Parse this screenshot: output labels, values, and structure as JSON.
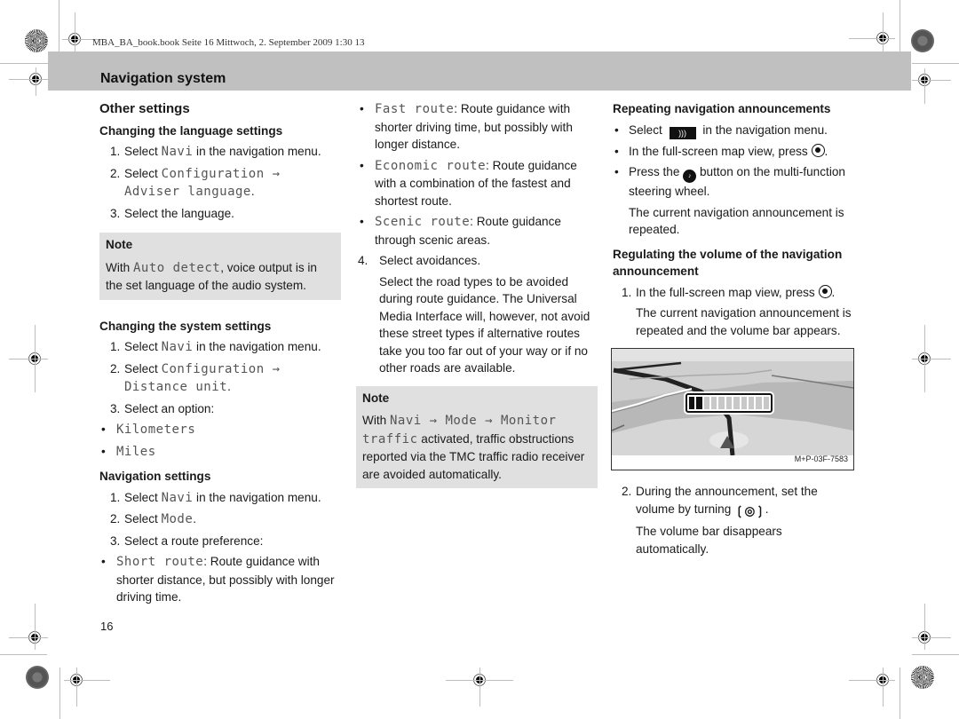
{
  "slug": "MBA_BA_book.book  Seite 16  Mittwoch, 2. September 2009  1:30 13",
  "section_title": "Navigation system",
  "page_number": "16",
  "col1": {
    "heading": "Other settings",
    "language": {
      "title": "Changing the language settings",
      "steps": [
        {
          "num": "1.",
          "pre": "Select ",
          "code": "Navi",
          "post": " in the navigation menu."
        },
        {
          "num": "2.",
          "pre": "Select ",
          "code": "Configuration → Adviser language",
          "post": "."
        },
        {
          "num": "3.",
          "pre": "Select the language.",
          "code": "",
          "post": ""
        }
      ]
    },
    "note": {
      "title": "Note",
      "pre": "With ",
      "code": "Auto detect",
      "post": ", voice output is in the set language of the audio system."
    },
    "system": {
      "title": "Changing the system settings",
      "steps": [
        {
          "num": "1.",
          "pre": "Select ",
          "code": "Navi",
          "post": " in the navigation menu."
        },
        {
          "num": "2.",
          "pre": "Select ",
          "code": "Configuration → Distance unit",
          "post": "."
        },
        {
          "num": "3.",
          "pre": "Select an option:",
          "code": "",
          "post": ""
        }
      ],
      "options": [
        "Kilometers",
        "Miles"
      ]
    },
    "navigation": {
      "title": "Navigation settings",
      "steps": [
        {
          "num": "1.",
          "pre": "Select ",
          "code": "Navi",
          "post": " in the navigation menu."
        },
        {
          "num": "2.",
          "pre": "Select ",
          "code": "Mode",
          "post": "."
        },
        {
          "num": "3.",
          "pre": "Select a route preference:",
          "code": "",
          "post": ""
        }
      ],
      "routes": [
        {
          "code": "Short route",
          "text": ": Route guidance with shorter distance, but possibly with longer driving time."
        }
      ]
    }
  },
  "col2": {
    "routes": [
      {
        "code": "Fast route",
        "text": ": Route guidance with shorter driving time, but possibly with longer distance."
      },
      {
        "code": "Economic route",
        "text": ": Route guidance with a combination of the fastest and shortest route."
      },
      {
        "code": "Scenic route",
        "text": ": Route guidance through scenic areas."
      }
    ],
    "step4": {
      "num": "4.",
      "text": "Select avoidances."
    },
    "step4_detail": "Select the road types to be avoided during route guidance. The Universal Media Interface will, however, not avoid these street types if alternative routes take you too far out of your way or if no other roads are available.",
    "note": {
      "title": "Note",
      "pre": "With ",
      "code": "Navi → Mode → Monitor traffic",
      "post": " activated, traffic obstructions reported via the TMC traffic radio receiver are avoided automatically."
    }
  },
  "col3": {
    "repeat": {
      "title": "Repeating navigation announcements",
      "bullets": [
        {
          "pre": "Select ",
          "icon": "voice-announcement-button",
          "post": " in the navigation menu."
        },
        {
          "pre": "In the full-screen map view, press ",
          "icon": "controller-press",
          "post": "."
        },
        {
          "pre": "Press the ",
          "icon": "steering-wheel-voice-button",
          "post": " button on the multi-function steering wheel."
        }
      ],
      "result": "The current navigation announcement is repeated."
    },
    "volume": {
      "title": "Regulating the volume of the navigation announcement",
      "step1": {
        "num": "1.",
        "pre": "In the full-screen map view, press ",
        "post": "."
      },
      "step1_result": "The current navigation announcement is repeated and the volume bar appears.",
      "figure": {
        "code": "M+P-03F-7583",
        "volume_segments_total": 11,
        "volume_segments_filled": 2
      },
      "step2": {
        "num": "2.",
        "pre": "During the announcement, set the volume by turning ",
        "post": "."
      },
      "step2_result": "The volume bar disappears automatically."
    }
  },
  "icons": {
    "voice_button_glyph": ")))",
    "steering_button_glyph": "♪"
  }
}
